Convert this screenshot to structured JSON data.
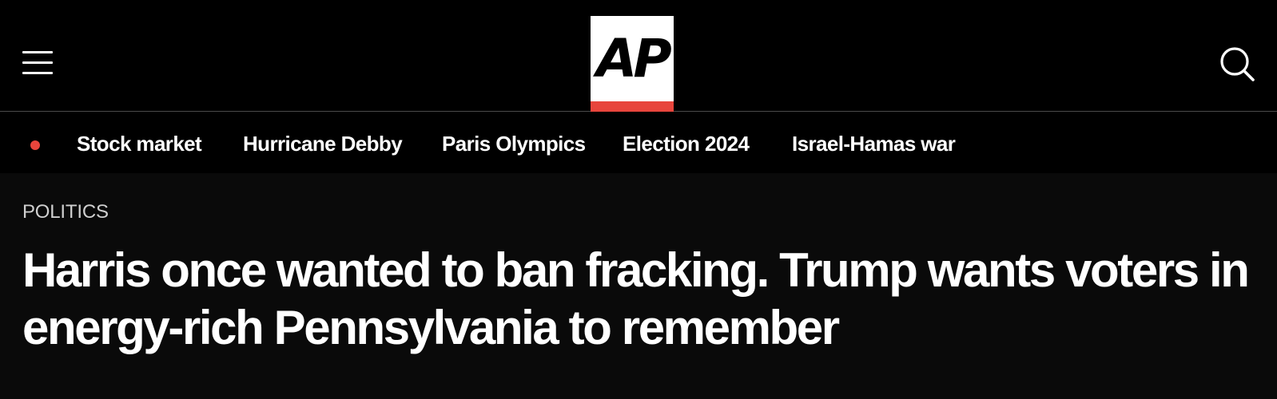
{
  "header": {
    "menu_icon": "hamburger-menu-icon",
    "logo_text": "AP",
    "logo_colors": {
      "background": "#ffffff",
      "text": "#000000",
      "accent_bar": "#e8453c"
    },
    "search_icon": "search-icon"
  },
  "nav": {
    "live_indicator_color": "#e8453c",
    "items": [
      {
        "label": "Stock market"
      },
      {
        "label": "Hurricane Debby"
      },
      {
        "label": "Paris Olympics"
      },
      {
        "label": "Election 2024"
      },
      {
        "label": "Israel-Hamas war"
      }
    ]
  },
  "article": {
    "kicker": "POLITICS",
    "headline": "Harris once wanted to ban fracking. Trump wants voters in energy-rich Pennsylvania to remember"
  }
}
